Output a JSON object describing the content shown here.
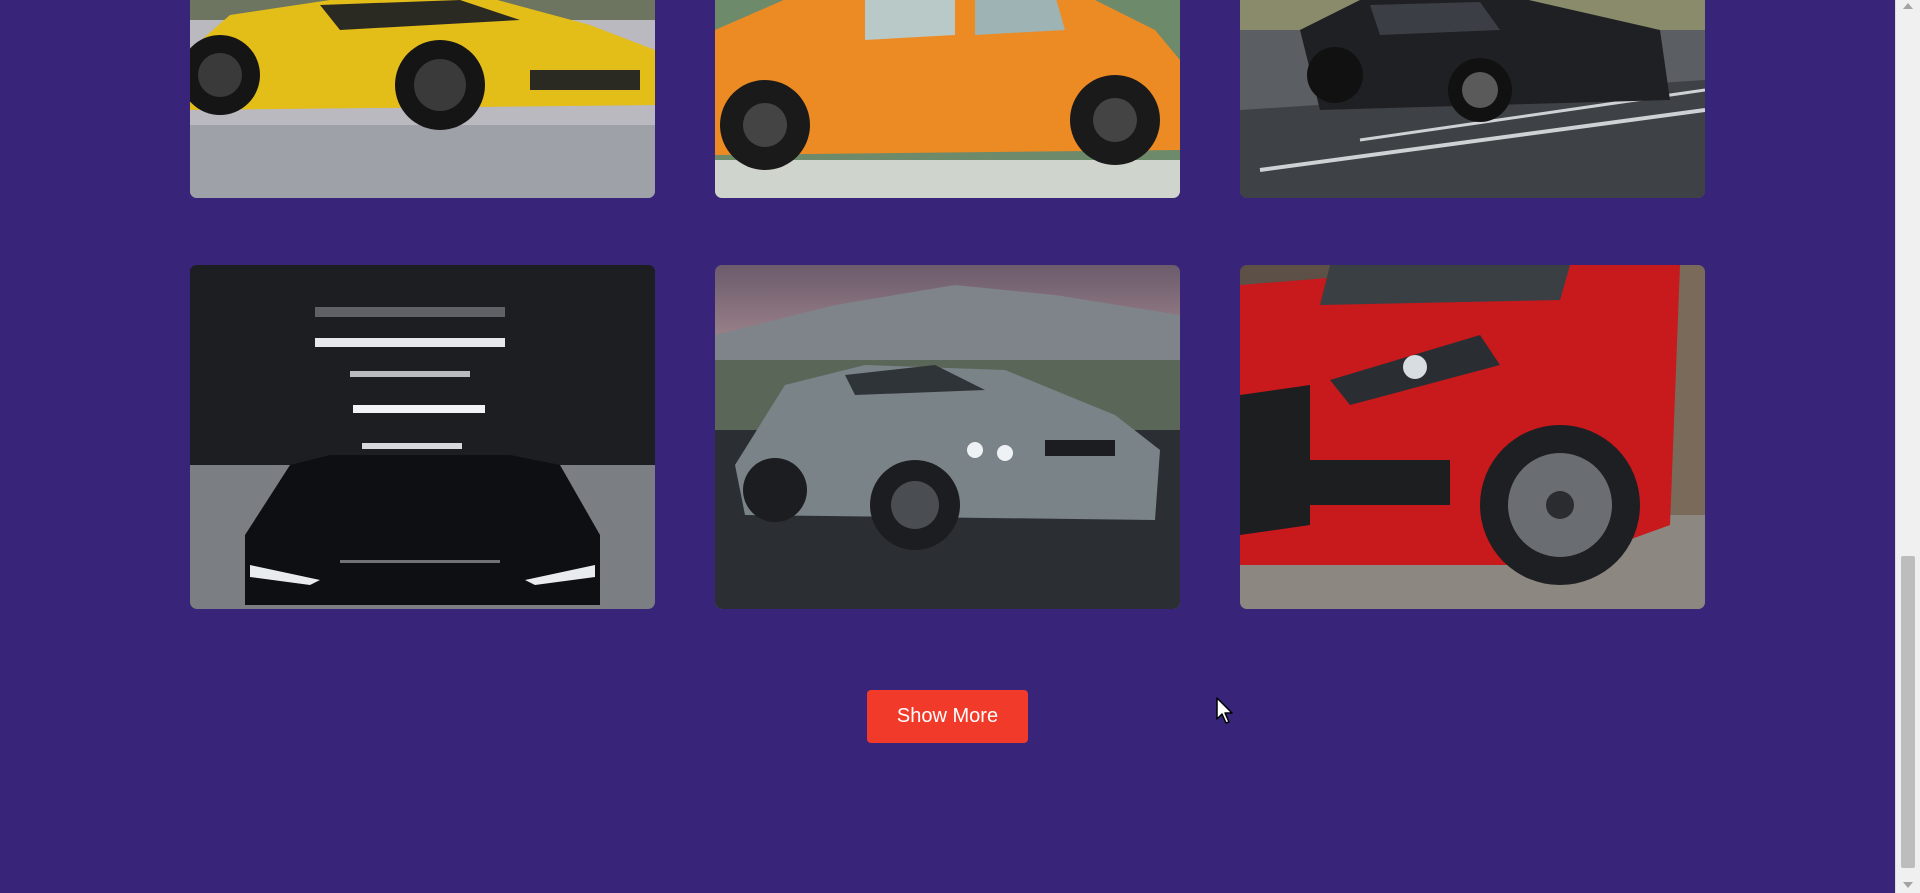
{
  "gallery": {
    "items": [
      {
        "name": "yellow-sports-car-photo",
        "body_color": "#e8c21c"
      },
      {
        "name": "orange-beetle-photo",
        "body_color": "#ec8a24"
      },
      {
        "name": "black-muscle-car-photo",
        "body_color": "#1f2024"
      },
      {
        "name": "dark-sedan-garage-photo",
        "body_color": "#0e0f12"
      },
      {
        "name": "grey-coupe-photo",
        "body_color": "#7a8388"
      },
      {
        "name": "red-hatchback-photo",
        "body_color": "#c8191c"
      }
    ]
  },
  "actions": {
    "show_more_label": "Show More"
  },
  "colors": {
    "page_background": "#38257a",
    "button_background": "#f23a2a",
    "button_text": "#ffffff"
  },
  "icons": {
    "cursor": "mouse-pointer-icon",
    "scroll_up": "scroll-up-arrow-icon",
    "scroll_down": "scroll-down-arrow-icon"
  }
}
